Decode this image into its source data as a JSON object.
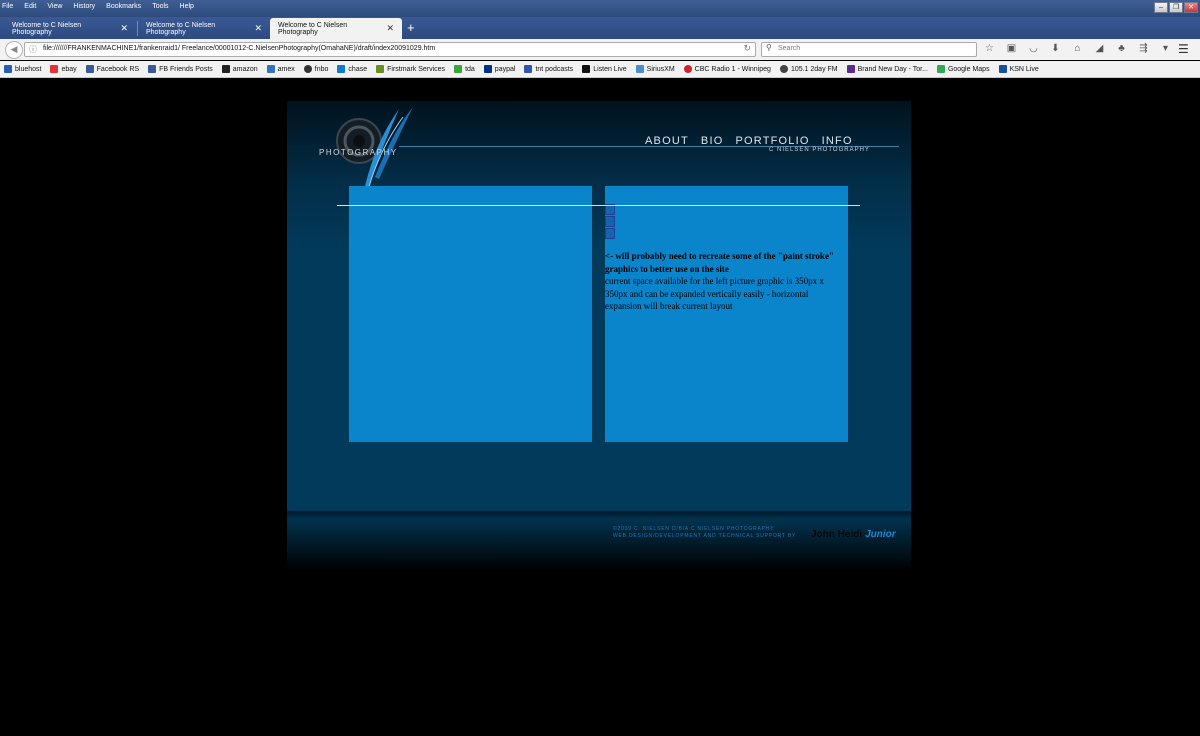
{
  "menu": [
    "File",
    "Edit",
    "View",
    "History",
    "Bookmarks",
    "Tools",
    "Help"
  ],
  "tabs": [
    {
      "title": "Welcome to C Nielsen Photography",
      "active": false
    },
    {
      "title": "Welcome to C Nielsen Photography",
      "active": false
    },
    {
      "title": "Welcome to C Nielsen Photography",
      "active": true
    }
  ],
  "address": {
    "url": "file:///////FRANKENMACHINE1/frankenraid1/ Freelance/00001012-C.NielsenPhotography(OmahaNE)/draft/index20091029.htm"
  },
  "search": {
    "placeholder": "Search"
  },
  "bookmarks": [
    {
      "label": "bluehost",
      "color": "#2a5db0"
    },
    {
      "label": "ebay",
      "color": "#e53238"
    },
    {
      "label": "Facebook RS",
      "color": "#3b5998"
    },
    {
      "label": "FB Friends Posts",
      "color": "#3b5998"
    },
    {
      "label": "amazon",
      "color": "#222222"
    },
    {
      "label": "amex",
      "color": "#2e77bb"
    },
    {
      "label": "fnbo",
      "color": "#333333"
    },
    {
      "label": "chase",
      "color": "#117aca"
    },
    {
      "label": "Firstmark Services",
      "color": "#6b8e23"
    },
    {
      "label": "tda",
      "color": "#3aa53a"
    },
    {
      "label": "paypal",
      "color": "#003087"
    },
    {
      "label": "tnt podcasts",
      "color": "#3355aa"
    },
    {
      "label": "Listen Live",
      "color": "#111111"
    },
    {
      "label": "SiriusXM",
      "color": "#4a90c8"
    },
    {
      "label": "CBC Radio 1 - Winnipeg",
      "color": "#d3202f"
    },
    {
      "label": "105.1 2day FM",
      "color": "#444444"
    },
    {
      "label": "Brand New Day - Tor...",
      "color": "#5a2d8c"
    },
    {
      "label": "Google Maps",
      "color": "#34a853"
    },
    {
      "label": "KSN Live",
      "color": "#1a4f9c"
    }
  ],
  "site": {
    "logo_text": "PHOTOGRAPHY",
    "nav": [
      "ABOUT",
      "BIO",
      "PORTFOLIO",
      "INFO"
    ],
    "subtitle": "C NIELSEN PHOTOGRAPHY",
    "note_bold": "<- will probably need to recreate some of the \"paint stroke\" graphics to better use on the site",
    "note_body": "current space available for the left picture graphic is 350px x 350px and can be expanded vertically easily - horizontal expansion will break current layout",
    "footer_line1": "©2009 C. NIELSEN D/B/A C NIELSEN PHOTOGRAPHY",
    "footer_line2": "WEB DESIGN/DEVELOPMENT AND TECHNICAL SUPPORT BY",
    "credit_name": "John Heidi",
    "credit_brand": "Junior"
  },
  "colors": {
    "content_box": "#0a85cc",
    "site_bg": "#023a5b",
    "chrome_blue": "#2e4a7c"
  }
}
